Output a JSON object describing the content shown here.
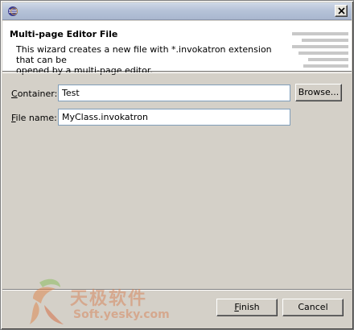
{
  "window": {
    "icon": "eclipse-icon",
    "close_icon": "close-icon"
  },
  "banner": {
    "title": "Multi-page Editor File",
    "description_line1": "This wizard creates a new file with *.invokatron extension that can be",
    "description_line2": "opened by a multi-page editor."
  },
  "form": {
    "container_label_mnemonic": "C",
    "container_label_rest": "ontainer:",
    "container_value": "Test",
    "browse_label": "Browse...",
    "filename_label_mnemonic": "F",
    "filename_label_rest": "ile name:",
    "filename_value": "MyClass.invokatron"
  },
  "buttons": {
    "finish_mnemonic": "F",
    "finish_rest": "inish",
    "cancel_label": "Cancel"
  },
  "watermark": {
    "chinese_text": "天极软件",
    "url_text": "Soft.yesky.com"
  }
}
